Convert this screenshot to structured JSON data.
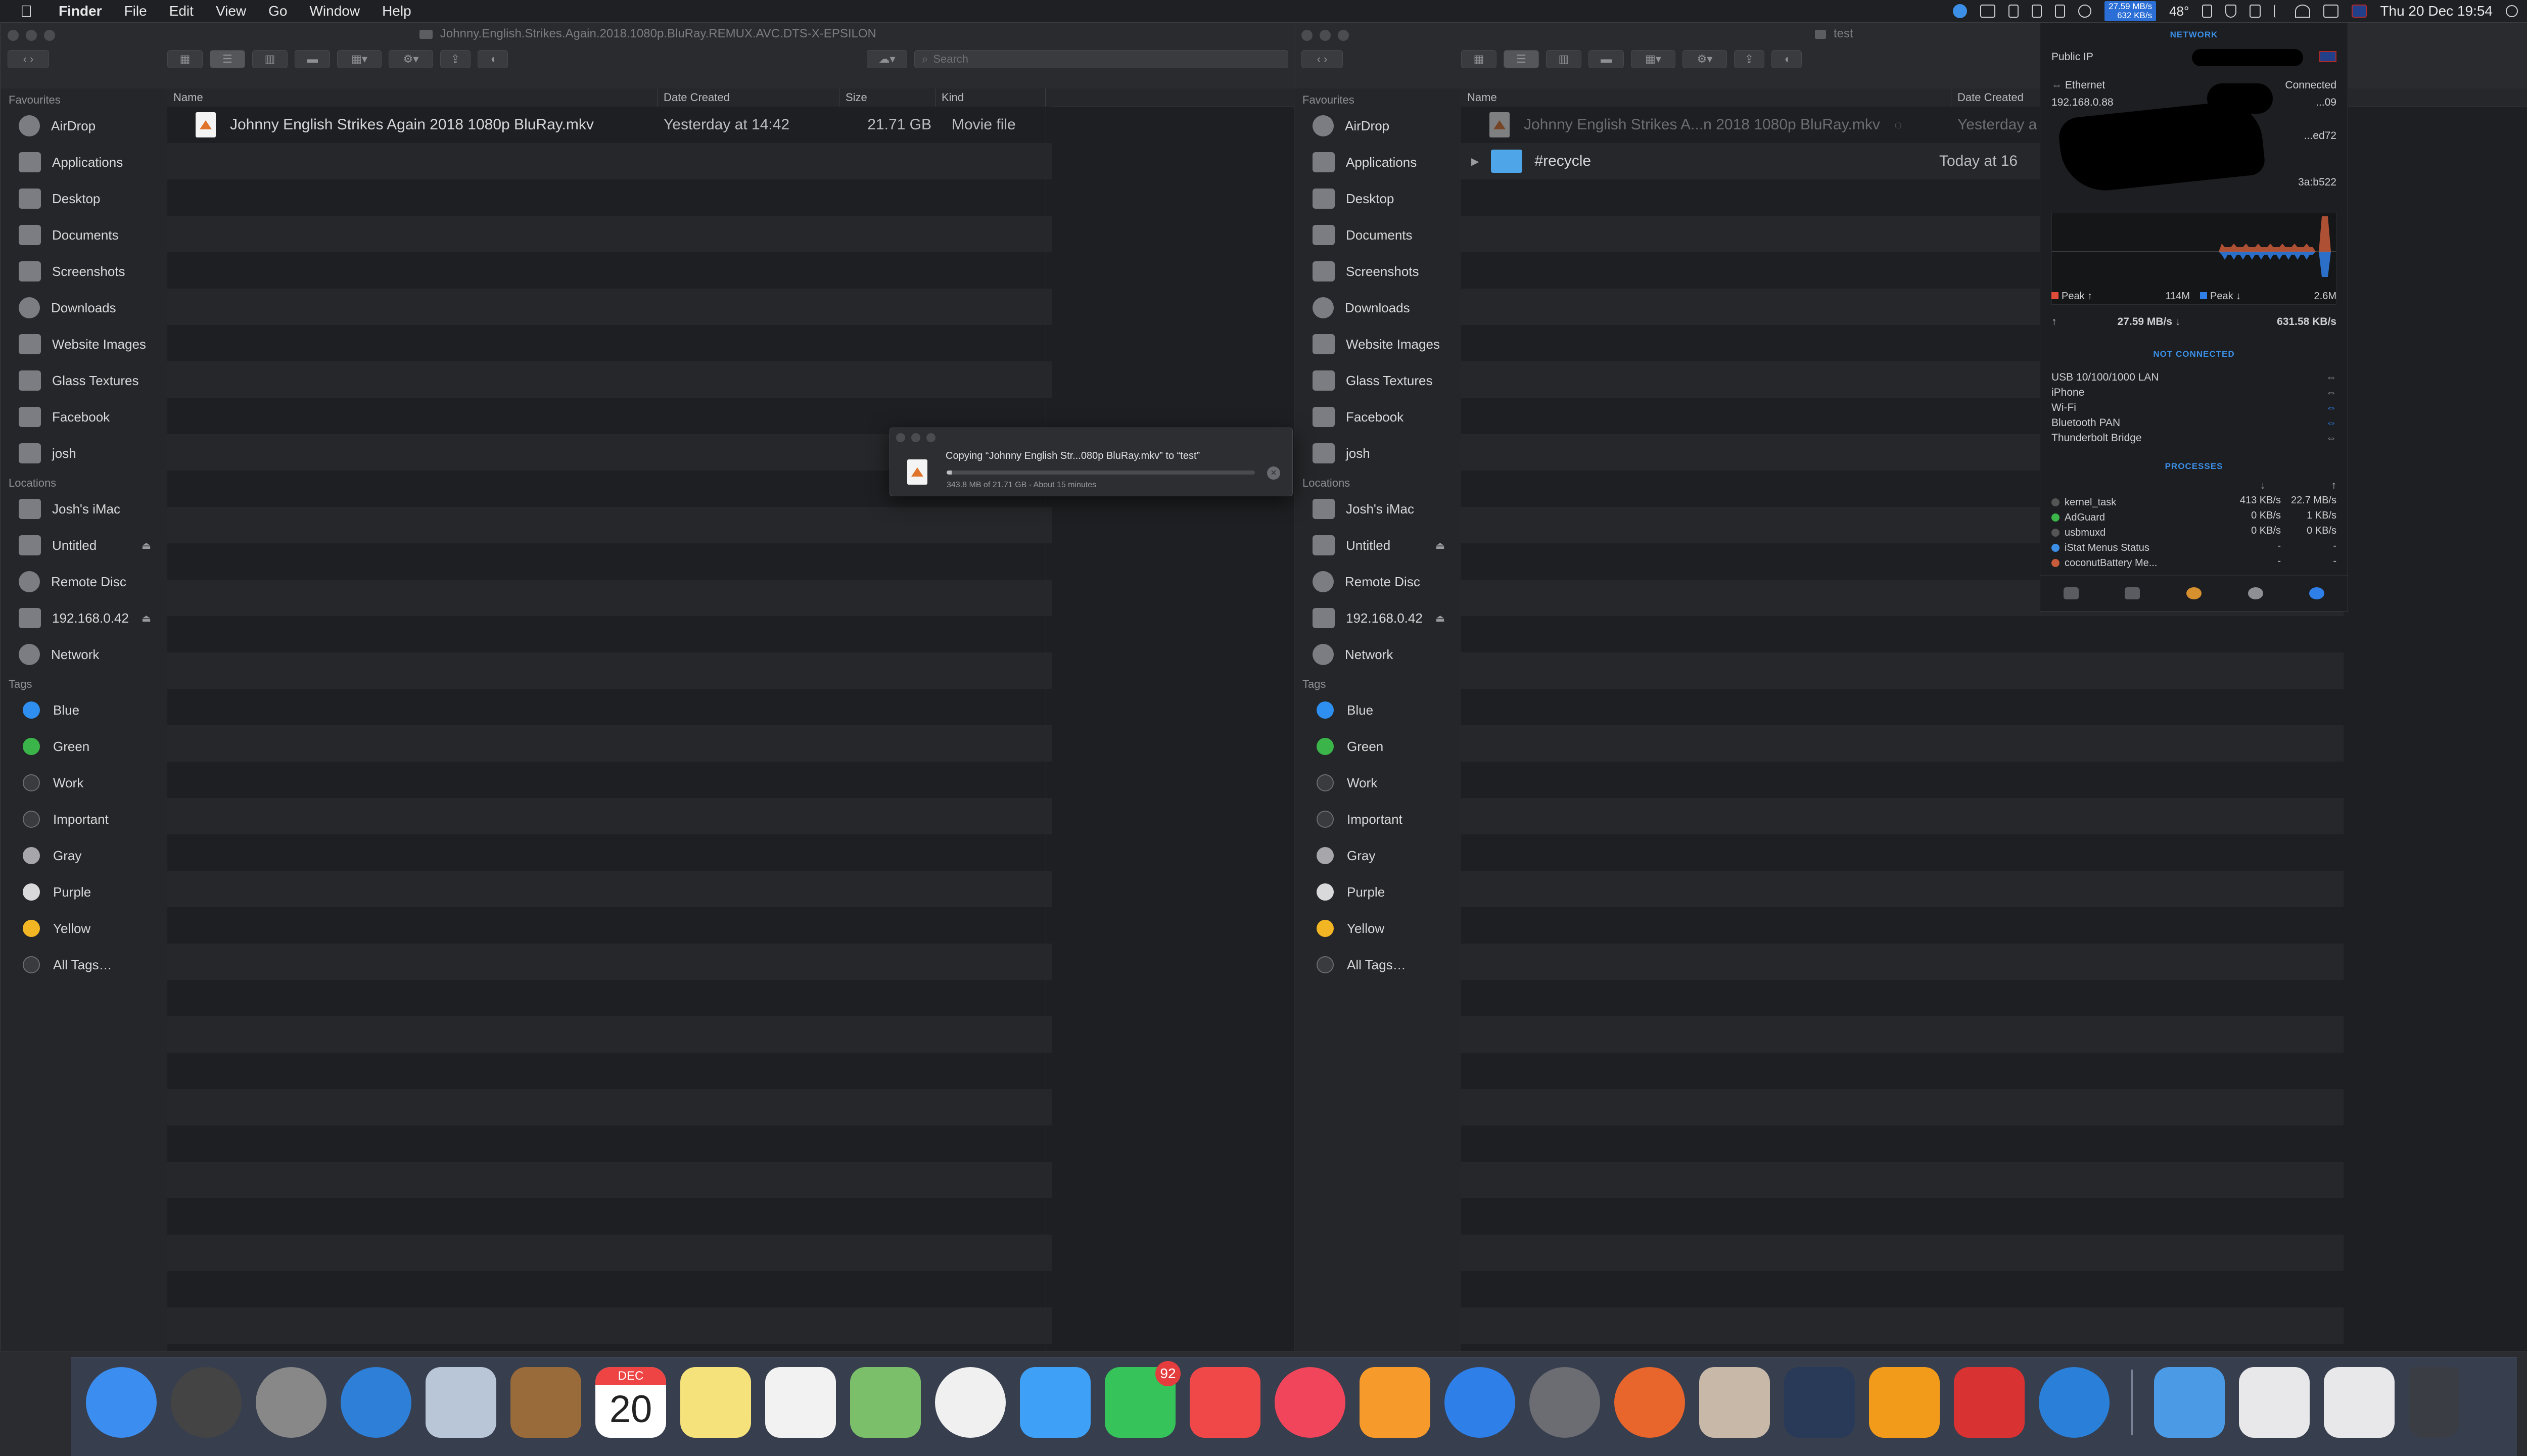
{
  "menubar": {
    "app": "Finder",
    "items": [
      "File",
      "Edit",
      "View",
      "Go",
      "Window",
      "Help"
    ],
    "net_up": "27.59 MB/s",
    "net_down": "632 KB/s",
    "temp": "48°",
    "datetime": "Thu 20 Dec 19:54"
  },
  "sidebar": {
    "favourites_header": "Favourites",
    "favourites": [
      "AirDrop",
      "Applications",
      "Desktop",
      "Documents",
      "Screenshots",
      "Downloads",
      "Website Images",
      "Glass Textures",
      "Facebook",
      "josh"
    ],
    "locations_header": "Locations",
    "locations": [
      "Josh's iMac",
      "Untitled",
      "Remote Disc",
      "192.168.0.42",
      "Network"
    ],
    "tags_header": "Tags",
    "tags": [
      {
        "label": "Blue",
        "color": "#2e8ff0"
      },
      {
        "label": "Green",
        "color": "#3bb54a"
      },
      {
        "label": "Work",
        "color": "#3a3b3f"
      },
      {
        "label": "Important",
        "color": "#3a3b3f"
      },
      {
        "label": "Gray",
        "color": "#a7a7ab"
      },
      {
        "label": "Purple",
        "color": "#d9d9dc"
      },
      {
        "label": "Yellow",
        "color": "#f2b624"
      },
      {
        "label": "All Tags…",
        "color": "#3a3b3f"
      }
    ]
  },
  "left_window": {
    "title": "Johnny.English.Strikes.Again.2018.1080p.BluRay.REMUX.AVC.DTS-X-EPSILON",
    "search_placeholder": "Search",
    "columns": [
      "Name",
      "Date Created",
      "Size",
      "Kind"
    ],
    "rows": [
      {
        "name": "Johnny English Strikes Again 2018 1080p BluRay.mkv",
        "date": "Yesterday at 14:42",
        "size": "21.71 GB",
        "kind": "Movie file"
      }
    ]
  },
  "right_window": {
    "title": "test",
    "columns": [
      "Name",
      "Date Created"
    ],
    "rows": [
      {
        "name": "Johnny English Strikes A...n 2018 1080p BluRay.mkv",
        "date": "Yesterday a"
      },
      {
        "name": "#recycle",
        "date": "Today at 16"
      }
    ]
  },
  "copy_dialog": {
    "title": "Copying “Johnny English Str...080p BluRay.mkv” to “test”",
    "progress": 0.016,
    "status": "343.8 MB of 21.71 GB - About 15 minutes"
  },
  "istat": {
    "network_header": "NETWORK",
    "public_ip_label": "Public IP",
    "ethernet_label": "Ethernet",
    "ethernet_status": "Connected",
    "ip_local": "192.168.0.88",
    "partial_1": "...09",
    "partial_2": "...ed72",
    "partial_3": "3a:b522",
    "peak_up_label": "Peak ↑",
    "peak_up_value": "114M",
    "peak_down_label": "Peak ↓",
    "peak_down_value": "2.6M",
    "upload_rate": "27.59 MB/s ↓",
    "download_rate": "631.58 KB/s",
    "not_connected_header": "NOT CONNECTED",
    "interfaces": [
      "USB 10/100/1000 LAN",
      "iPhone",
      "Wi-Fi",
      "Bluetooth PAN",
      "Thunderbolt Bridge"
    ],
    "processes_header": "PROCESSES",
    "processes": [
      {
        "name": "kernel_task",
        "down": "413 KB/s",
        "up": "22.7 MB/s",
        "color": "#555"
      },
      {
        "name": "AdGuard",
        "down": "0 KB/s",
        "up": "1 KB/s",
        "color": "#3bb54a"
      },
      {
        "name": "usbmuxd",
        "down": "0 KB/s",
        "up": "0 KB/s",
        "color": "#555"
      },
      {
        "name": "iStat Menus Status",
        "down": "-",
        "up": "-",
        "color": "#3b8fe6"
      },
      {
        "name": "coconutBattery Me...",
        "down": "-",
        "up": "-",
        "color": "#c85b3a"
      }
    ]
  },
  "dock": {
    "calendar_month": "DEC",
    "calendar_day": "20",
    "facetime_badge": "92",
    "apps": [
      {
        "name": "finder",
        "color": "#3c8df0"
      },
      {
        "name": "siri",
        "color": "#444"
      },
      {
        "name": "launchpad",
        "color": "#888"
      },
      {
        "name": "safari",
        "color": "#2e7fd8"
      },
      {
        "name": "mail",
        "color": "#b8c6d8"
      },
      {
        "name": "contacts",
        "color": "#9a6b3a"
      },
      {
        "name": "calendar",
        "color": "#ffffff"
      },
      {
        "name": "notes",
        "color": "#f6e27a"
      },
      {
        "name": "reminders",
        "color": "#f2f2f2"
      },
      {
        "name": "maps",
        "color": "#7bbf6a"
      },
      {
        "name": "photos",
        "color": "#f0f0f0"
      },
      {
        "name": "messages",
        "color": "#3ea1f7"
      },
      {
        "name": "facetime",
        "color": "#35c35a"
      },
      {
        "name": "news",
        "color": "#f04848"
      },
      {
        "name": "music",
        "color": "#f0455a"
      },
      {
        "name": "books",
        "color": "#f59a2b"
      },
      {
        "name": "app-store",
        "color": "#2f7fe8"
      },
      {
        "name": "system-preferences",
        "color": "#6c6d72"
      },
      {
        "name": "firefox",
        "color": "#e8662c"
      },
      {
        "name": "image-capture",
        "color": "#c7b8a8"
      },
      {
        "name": "hexagon-app",
        "color": "#283a58"
      },
      {
        "name": "pages-like",
        "color": "#f29b1b"
      },
      {
        "name": "pro-app",
        "color": "#d83232"
      },
      {
        "name": "wifi-app",
        "color": "#2a80d8"
      }
    ]
  }
}
